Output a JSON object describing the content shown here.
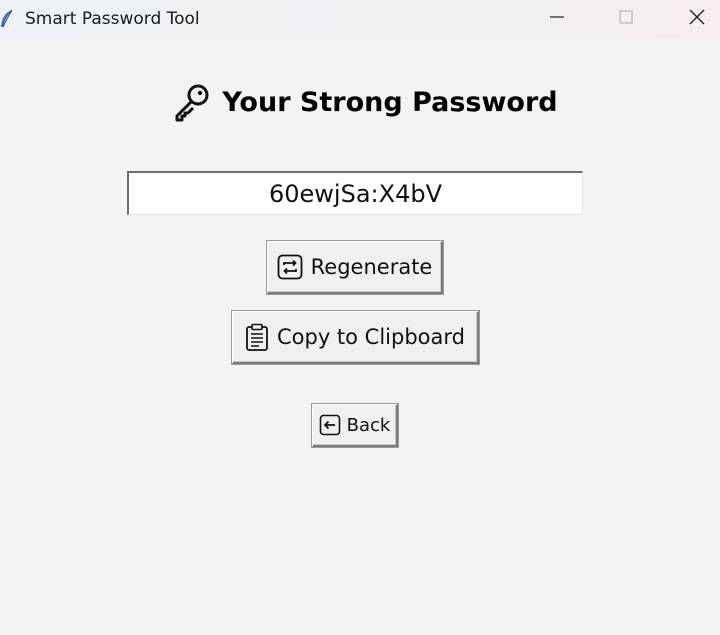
{
  "window": {
    "title": "Smart Password Tool",
    "icons": {
      "app": "feather-icon",
      "minimize": "minimize-icon",
      "maximize": "maximize-icon",
      "close": "close-icon"
    }
  },
  "main": {
    "heading": "Your Strong Password",
    "heading_icon": "key-icon",
    "password_value": "60ewjSa:X4bV",
    "buttons": {
      "regenerate_label": "Regenerate",
      "regenerate_icon": "repeat-icon",
      "copy_label": "Copy to Clipboard",
      "copy_icon": "clipboard-icon",
      "back_label": "Back",
      "back_icon": "back-arrow-icon"
    }
  }
}
